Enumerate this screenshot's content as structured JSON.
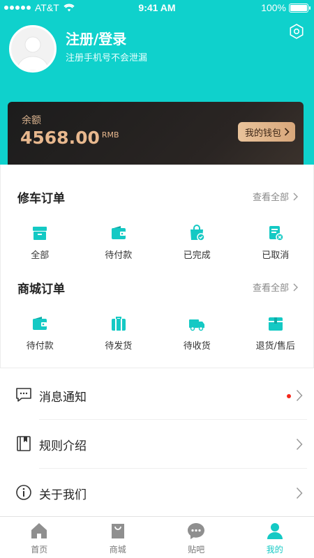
{
  "status_bar": {
    "carrier": "AT&T",
    "time": "9:41 AM",
    "battery": "100%",
    "battery_level": 1.0
  },
  "profile": {
    "title": "注册/登录",
    "subtitle": "注册手机号不会泄漏"
  },
  "wallet": {
    "label": "余额",
    "amount": "4568.00",
    "unit": "RMB",
    "button_label": "我的钱包"
  },
  "repair_orders": {
    "title": "修车订单",
    "view_all": "查看全部",
    "items": [
      {
        "label": "全部",
        "icon": "box-icon"
      },
      {
        "label": "待付款",
        "icon": "wallet-icon"
      },
      {
        "label": "已完成",
        "icon": "shopping-bag-check-icon"
      },
      {
        "label": "已取消",
        "icon": "document-cancel-icon"
      }
    ]
  },
  "mall_orders": {
    "title": "商城订单",
    "view_all": "查看全部",
    "items": [
      {
        "label": "待付款",
        "icon": "wallet-icon"
      },
      {
        "label": "待发货",
        "icon": "suitcase-icon"
      },
      {
        "label": "待收货",
        "icon": "truck-icon"
      },
      {
        "label": "退货/售后",
        "icon": "package-return-icon"
      }
    ]
  },
  "menu": [
    {
      "label": "消息通知",
      "icon": "message-icon",
      "has_badge": true
    },
    {
      "label": "规则介绍",
      "icon": "book-icon",
      "has_badge": false
    },
    {
      "label": "关于我们",
      "icon": "info-icon",
      "has_badge": false
    }
  ],
  "tabbar": [
    {
      "label": "首页",
      "icon": "home-icon",
      "active": false
    },
    {
      "label": "商城",
      "icon": "shopping-bag-icon",
      "active": false
    },
    {
      "label": "贴吧",
      "icon": "chat-bubble-icon",
      "active": false
    },
    {
      "label": "我的",
      "icon": "user-icon",
      "active": true
    }
  ],
  "colors": {
    "primary": "#0fd1cc",
    "gold": "#e8b88e",
    "badge": "#f4271b"
  }
}
